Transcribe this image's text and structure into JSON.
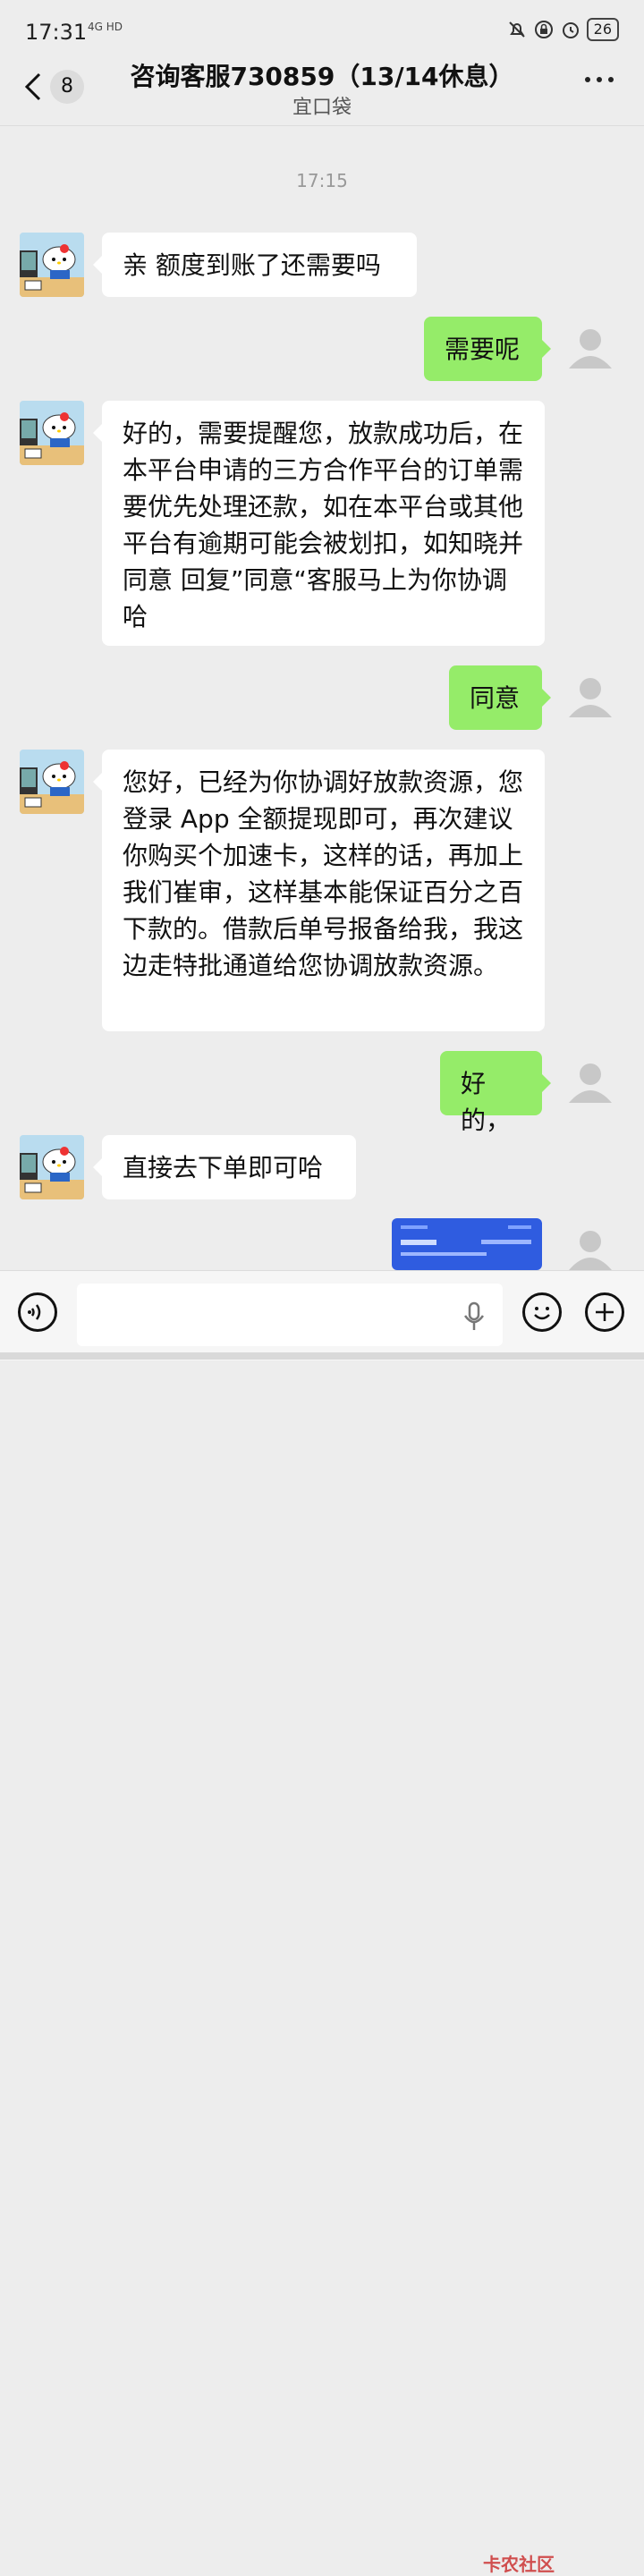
{
  "status_bar": {
    "time": "17:31",
    "network": "4G HD",
    "battery": "26"
  },
  "header": {
    "unread_count": "8",
    "title": "咨询客服730859（13/14休息）",
    "subtitle": "宜口袋"
  },
  "timestamp": "17:15",
  "messages": [
    {
      "side": "in",
      "text": "亲 额度到账了还需要吗"
    },
    {
      "side": "out",
      "text": "需要呢"
    },
    {
      "side": "in",
      "text": "好的，需要提醒您，放款成功后，在本平台申请的三方合作平台的订单需要优先处理还款，如在本平台或其他平台有逾期可能会被划扣，如知晓并同意 回复”同意“客服马上为你协调哈"
    },
    {
      "side": "out",
      "text": "同意"
    },
    {
      "side": "in",
      "text": "您好，已经为你协调好放款资源，您登录 App 全额提现即可，再次建议你购买个加速卡，这样的话，再加上我们崔审，这样基本能保证百分之百下款的。借款后单号报备给我，我这边走特批通道给您协调放款资源。"
    },
    {
      "side": "out",
      "text": "好的，"
    },
    {
      "side": "in",
      "text": "直接去下单即可哈"
    },
    {
      "side": "out",
      "type": "image"
    }
  ],
  "watermark": "卡农社区",
  "colors": {
    "background": "#ededed",
    "outgoing_bubble": "#95ec69",
    "incoming_bubble": "#ffffff"
  }
}
